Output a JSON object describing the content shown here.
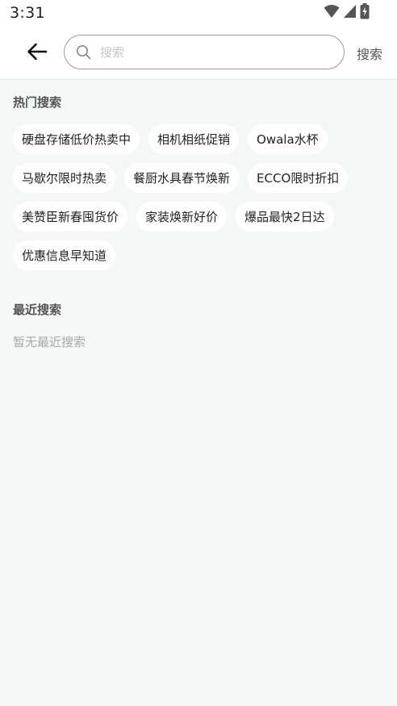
{
  "status_bar": {
    "time": "3:31",
    "icons": [
      "wifi-icon",
      "cellular-signal-icon",
      "battery-charging-icon"
    ]
  },
  "header": {
    "back_icon": "arrow-left-icon",
    "search_placeholder": "搜索",
    "search_value": "",
    "search_button_label": "搜索"
  },
  "hot_search": {
    "title": "热门搜索",
    "items": [
      "硬盘存储低价热卖中",
      "相机相纸促销",
      "Owala水杯",
      "马歇尔限时热卖",
      "餐厨水具春节焕新",
      "ECCO限时折扣",
      "美赞臣新春囤货价",
      "家装焕新好价",
      "爆品最快2日达",
      "优惠信息早知道"
    ]
  },
  "recent_search": {
    "title": "最近搜索",
    "empty_text": "暂无最近搜索"
  },
  "colors": {
    "background": "#f5f6f6",
    "surface": "#ffffff",
    "text_primary": "#222222",
    "text_secondary": "#555555",
    "text_hint": "#a8a8a8"
  }
}
